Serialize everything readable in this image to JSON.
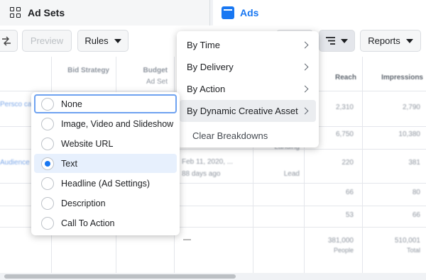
{
  "tabs": {
    "adsets_label": "Ad Sets",
    "ads_label": "Ads"
  },
  "toolbar": {
    "preview_label": "Preview",
    "rules_label": "Rules",
    "reports_label": "Reports"
  },
  "table": {
    "headers": {
      "bid_strategy": "Bid Strategy",
      "budget": "Budget",
      "ad_set": "Ad Set",
      "reach": "Reach",
      "impressions": "Impressions"
    },
    "rows": [
      {
        "name": "Persco cal",
        "reach": "2,310",
        "impressions": "2,790"
      },
      {
        "name": "",
        "status": "Landing",
        "reach": "6,750",
        "impressions": "10,380"
      },
      {
        "name": "Audience",
        "date": "Feb 11, 2020, ...",
        "ago": "88 days ago",
        "status": "Lead",
        "reach": "220",
        "impressions": "381"
      },
      {
        "reach": "66",
        "impressions": "80"
      },
      {
        "reach": "53",
        "impressions": "66"
      }
    ],
    "summary": {
      "dash": "—",
      "reach": "381,000",
      "reach_note": "People",
      "impressions": "510,001",
      "impressions_note": "Total"
    }
  },
  "breakdown_menu": {
    "items": [
      "By Time",
      "By Delivery",
      "By Action",
      "By Dynamic Creative Asset"
    ],
    "clear_label": "Clear Breakdowns"
  },
  "asset_submenu": {
    "options": [
      "None",
      "Image, Video and Slideshow",
      "Website URL",
      "Text",
      "Headline (Ad Settings)",
      "Description",
      "Call To Action"
    ],
    "selected": "Text",
    "focused": "None"
  },
  "colors": {
    "accent": "#1877f2",
    "selected_bg": "#e7f0fd",
    "focus_ring": "#6ea2f0"
  }
}
